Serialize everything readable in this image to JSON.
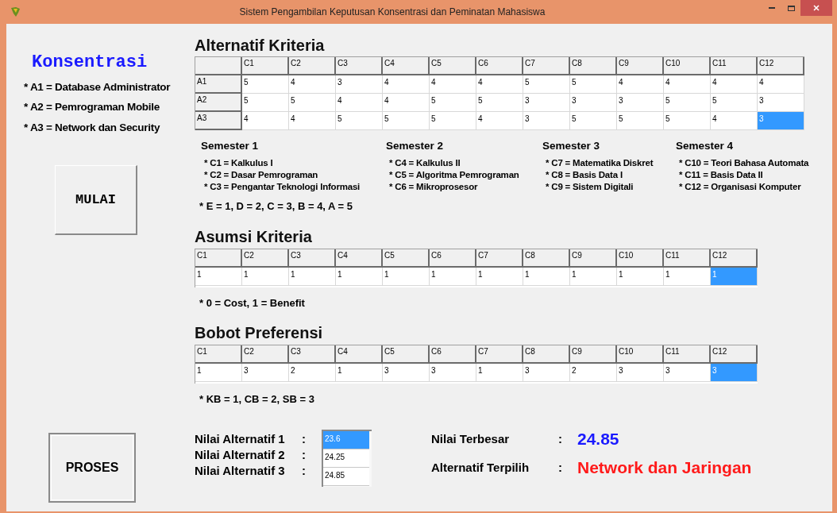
{
  "window": {
    "title": "Sistem Pengambilan Keputusan Konsentrasi dan Peminatan Mahasiswa"
  },
  "konsentrasi": {
    "title": "Konsentrasi",
    "items": [
      "* A1 = Database Administrator",
      "* A2 = Pemrograman Mobile",
      "* A3 = Network dan Security"
    ]
  },
  "buttons": {
    "mulai": "MULAI",
    "proses": "PROSES"
  },
  "alternatif_kriteria": {
    "title": "Alternatif Kriteria",
    "columns": [
      "C1",
      "C2",
      "C3",
      "C4",
      "C5",
      "C6",
      "C7",
      "C8",
      "C9",
      "C10",
      "C11",
      "C12"
    ],
    "rows": [
      {
        "label": "A1",
        "cells": [
          {
            "value": "5",
            "selected": false
          },
          {
            "value": "4",
            "selected": false
          },
          {
            "value": "3",
            "selected": false
          },
          {
            "value": "4",
            "selected": false
          },
          {
            "value": "4",
            "selected": false
          },
          {
            "value": "4",
            "selected": false
          },
          {
            "value": "5",
            "selected": false
          },
          {
            "value": "5",
            "selected": false
          },
          {
            "value": "4",
            "selected": false
          },
          {
            "value": "4",
            "selected": false
          },
          {
            "value": "4",
            "selected": false
          },
          {
            "value": "4",
            "selected": false
          }
        ]
      },
      {
        "label": "A2",
        "cells": [
          {
            "value": "5",
            "selected": false
          },
          {
            "value": "5",
            "selected": false
          },
          {
            "value": "4",
            "selected": false
          },
          {
            "value": "4",
            "selected": false
          },
          {
            "value": "5",
            "selected": false
          },
          {
            "value": "5",
            "selected": false
          },
          {
            "value": "3",
            "selected": false
          },
          {
            "value": "3",
            "selected": false
          },
          {
            "value": "3",
            "selected": false
          },
          {
            "value": "5",
            "selected": false
          },
          {
            "value": "5",
            "selected": false
          },
          {
            "value": "3",
            "selected": false
          }
        ]
      },
      {
        "label": "A3",
        "cells": [
          {
            "value": "4",
            "selected": false
          },
          {
            "value": "4",
            "selected": false
          },
          {
            "value": "5",
            "selected": false
          },
          {
            "value": "5",
            "selected": false
          },
          {
            "value": "5",
            "selected": false
          },
          {
            "value": "4",
            "selected": false
          },
          {
            "value": "3",
            "selected": false
          },
          {
            "value": "5",
            "selected": false
          },
          {
            "value": "5",
            "selected": false
          },
          {
            "value": "5",
            "selected": false
          },
          {
            "value": "4",
            "selected": false
          },
          {
            "value": "3",
            "selected": true
          }
        ]
      }
    ]
  },
  "semesters": [
    {
      "title": "Semester 1",
      "items": [
        "* C1 = Kalkulus I",
        "* C2 = Dasar Pemrograman",
        "* C3 = Pengantar Teknologi Informasi"
      ]
    },
    {
      "title": "Semester 2",
      "items": [
        "* C4 = Kalkulus II",
        "* C5 = Algoritma Pemrograman",
        "* C6 = Mikroprosesor"
      ]
    },
    {
      "title": "Semester 3",
      "items": [
        "* C7 = Matematika Diskret",
        "* C8 = Basis Data I",
        "* C9 = Sistem Digitali"
      ]
    },
    {
      "title": "Semester 4",
      "items": [
        "* C10 = Teori Bahasa Automata",
        "* C11 = Basis Data II",
        "* C12 = Organisasi Komputer"
      ]
    }
  ],
  "grade_note": "* E = 1, D = 2, C = 3, B = 4, A = 5",
  "asumsi_kriteria": {
    "title": "Asumsi Kriteria",
    "columns": [
      "C1",
      "C2",
      "C3",
      "C4",
      "C5",
      "C6",
      "C7",
      "C8",
      "C9",
      "C10",
      "C11",
      "C12"
    ],
    "cells": [
      {
        "value": "1",
        "selected": false
      },
      {
        "value": "1",
        "selected": false
      },
      {
        "value": "1",
        "selected": false
      },
      {
        "value": "1",
        "selected": false
      },
      {
        "value": "1",
        "selected": false
      },
      {
        "value": "1",
        "selected": false
      },
      {
        "value": "1",
        "selected": false
      },
      {
        "value": "1",
        "selected": false
      },
      {
        "value": "1",
        "selected": false
      },
      {
        "value": "1",
        "selected": false
      },
      {
        "value": "1",
        "selected": false
      },
      {
        "value": "1",
        "selected": true
      }
    ],
    "note": "* 0 = Cost, 1 = Benefit"
  },
  "bobot_preferensi": {
    "title": "Bobot Preferensi",
    "columns": [
      "C1",
      "C2",
      "C3",
      "C4",
      "C5",
      "C6",
      "C7",
      "C8",
      "C9",
      "C10",
      "C11",
      "C12"
    ],
    "cells": [
      {
        "value": "1",
        "selected": false
      },
      {
        "value": "3",
        "selected": false
      },
      {
        "value": "2",
        "selected": false
      },
      {
        "value": "1",
        "selected": false
      },
      {
        "value": "3",
        "selected": false
      },
      {
        "value": "3",
        "selected": false
      },
      {
        "value": "1",
        "selected": false
      },
      {
        "value": "3",
        "selected": false
      },
      {
        "value": "2",
        "selected": false
      },
      {
        "value": "3",
        "selected": false
      },
      {
        "value": "3",
        "selected": false
      },
      {
        "value": "3",
        "selected": true
      }
    ],
    "note": "* KB = 1, CB = 2, SB = 3"
  },
  "nilai_alternatif": {
    "labels": [
      "Nilai Alternatif 1",
      "Nilai Alternatif 2",
      "Nilai Alternatif 3"
    ],
    "colon": ":",
    "items": [
      {
        "value": "23.6",
        "selected": true
      },
      {
        "value": "24.25",
        "selected": false
      },
      {
        "value": "24.85",
        "selected": false
      }
    ]
  },
  "result": {
    "nilai_terbesar_label": "Nilai Terbesar",
    "nilai_terbesar_colon": ":",
    "nilai_terbesar": "24.85",
    "terpilih_label": "Alternatif Terpilih",
    "terpilih_colon": ":",
    "terpilih": "Network dan Jaringan"
  }
}
